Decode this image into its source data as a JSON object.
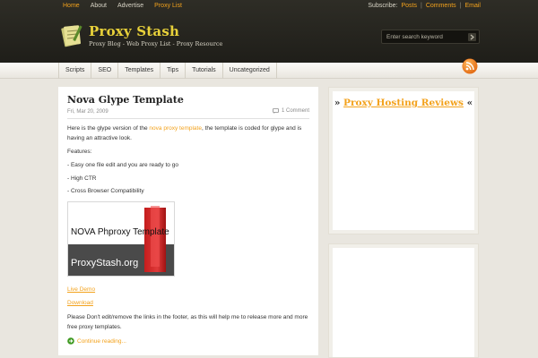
{
  "top_nav": {
    "items": [
      {
        "label": "Home",
        "active": true
      },
      {
        "label": "About",
        "active": false
      },
      {
        "label": "Advertise",
        "active": false
      },
      {
        "label": "Proxy List",
        "active": true
      }
    ]
  },
  "subscribe": {
    "label": "Subscribe:",
    "posts": "Posts",
    "comments": "Comments",
    "email": "Email",
    "separator": "|"
  },
  "site": {
    "title": "Proxy Stash",
    "tagline": "Proxy Blog - Web Proxy List - Proxy Resource"
  },
  "search": {
    "placeholder": "Enter search keyword"
  },
  "categories": [
    "Scripts",
    "SEO",
    "Templates",
    "Tips",
    "Tutorials",
    "Uncategorized"
  ],
  "post": {
    "title": "Nova Glype Template",
    "date": "Fri, Mar 20, 2009",
    "comments": "1 Comment",
    "intro_before": "Here is the glype version of the ",
    "intro_link": "nova proxy template",
    "intro_after": ", the template is coded for glype and is having an attractive look.",
    "features_label": "Features:",
    "features": [
      "- Easy one file edit and you are ready to go",
      "- High CTR",
      "- Cross Browser Compatibility"
    ],
    "image_text_top": "NOVA Phproxy Template",
    "image_text_bottom": "ProxyStash.org",
    "live_demo": "Live Demo",
    "download": "Download",
    "footer_note": "Please Don't edit/remove the links in the footer, as this will help me to release more and more free proxy templates.",
    "continue": "Continue reading..."
  },
  "sidebar": {
    "title_left": "»",
    "title_link": "Proxy Hosting Reviews",
    "title_right": "«"
  },
  "colors": {
    "accent": "#f3a21c",
    "logo_title": "#e8d13a",
    "header_bg": "#262520",
    "page_bg": "#e9e6df"
  }
}
